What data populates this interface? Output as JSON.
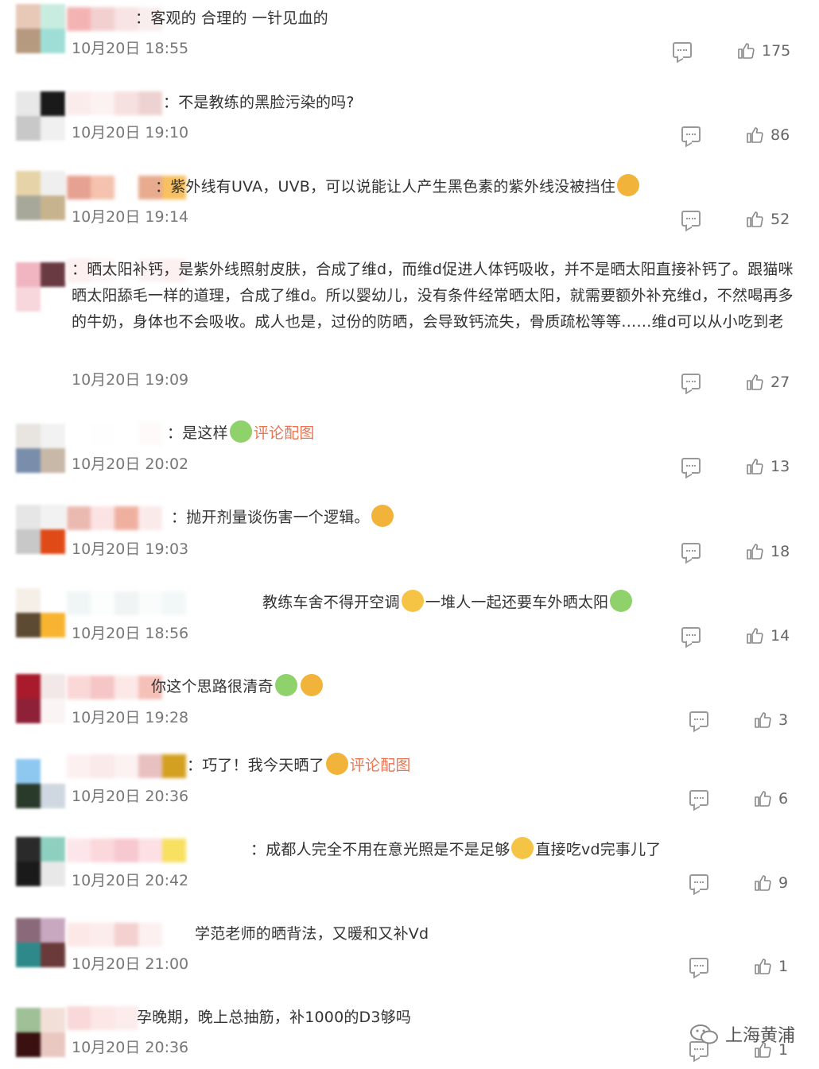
{
  "comments": [
    {
      "text": "：客观的 合理的 一针见血的",
      "time": "10月20日 18:55",
      "likes": "175",
      "avatar": [
        "#e8c9b8",
        "#c8ede0",
        "#b59a7f",
        "#9fded6"
      ],
      "nick": [
        "#f4b3b3",
        "#f2d0d0",
        "#f8e4e4",
        "#f9eeee"
      ]
    },
    {
      "text": "：不是教练的黑脸污染的吗?",
      "time": "10月20日 19:10",
      "likes": "86",
      "avatar": [
        "#e8e8e8",
        "#1a1a1a",
        "#c8c8c8",
        "#f0f0f0"
      ],
      "nick": [
        "#fbecec",
        "#fdf2f2",
        "#f7e0e0",
        "#eed2d2"
      ]
    },
    {
      "text": "：紫外线有UVA，UVB，可以说能让人产生黑色素的紫外线没被挡住",
      "time": "10月20日 19:14",
      "likes": "52",
      "avatar": [
        "#e6d4a8",
        "#efefef",
        "#a8a89a",
        "#c7b38e"
      ],
      "nick": [
        "#e6a190",
        "#f4c2ae",
        "#ffffff",
        "#e8ab8e",
        "#f7c060"
      ]
    },
    {
      "text": "：晒太阳补钙，是紫外线照射皮肤，合成了维d，而维d促进人体钙吸收，并不是晒太阳直接补钙了。跟猫咪晒太阳舔毛一样的道理，合成了维d。所以婴幼儿，没有条件经常晒太阳，就需要额外补充维d，不然喝再多的牛奶，身体也不会吸收。成人也是，过份的防晒，会导致钙流失，骨质疏松等等……维d可以从小吃到老",
      "time": "10月20日 19:09",
      "likes": "27",
      "avatar": [
        "#f0b5c1",
        "#6a3a42",
        "#f7d6dc",
        "#ffffff"
      ],
      "nick": [
        "#fcf0f0",
        "#fef6f6",
        "#ffffff",
        "#fcf4f4",
        "#fdf0f0"
      ]
    },
    {
      "text": "：是这样",
      "link": "评论配图",
      "time": "10月20日 20:02",
      "likes": "13",
      "avatar": [
        "#e8e4e0",
        "#f2f2f2",
        "#7a8dab",
        "#c8b8a8"
      ],
      "nick": [
        "#ffffff",
        "#fefefe",
        "#ffffff",
        "#fefafa"
      ]
    },
    {
      "text": "：抛开剂量谈伤害一个逻辑。",
      "time": "10月20日 19:03",
      "likes": "18",
      "avatar": [
        "#e6e6e6",
        "#f2f2f2",
        "#c8c8c8",
        "#e04a17"
      ],
      "nick": [
        "#eab9b0",
        "#fbe3e3",
        "#f0b0a0",
        "#fbeaea",
        "#ffffff"
      ]
    },
    {
      "text": "教练车舍不得开空调",
      "text2": "一堆人一起还要车外晒太阳",
      "time": "10月20日 18:56",
      "likes": "14",
      "avatar": [
        "#f6efe8",
        "#ffffff",
        "#5c4a32",
        "#f8b430"
      ],
      "nick": [
        "#f0f6f6",
        "#fcfefe",
        "#f0f4f4",
        "#fafcfc",
        "#f2f8f8"
      ]
    },
    {
      "text": "你这个思路很清奇",
      "time": "10月20日 19:28",
      "likes": "3",
      "avatar": [
        "#a81a2c",
        "#f2e8e8",
        "#8e2038",
        "#fbf4f4"
      ],
      "nick": [
        "#fad8d8",
        "#f6c5c5",
        "#fde8e8",
        "#f5c0b8"
      ]
    },
    {
      "text": "：巧了！我今天晒了",
      "link": "评论配图",
      "time": "10月20日 20:36",
      "likes": "6",
      "avatar": [
        "#8ec8f0",
        "#ffffff",
        "#2a3a2a",
        "#cfd8e0"
      ],
      "nick": [
        "#fdf0f0",
        "#faeaea",
        "#fcf2f2",
        "#e8c0c0",
        "#d4a020"
      ]
    },
    {
      "text": "：成都人完全不用在意光照是不是足够",
      "text2": "直接吃vd完事儿了",
      "time": "10月20日 20:42",
      "likes": "9",
      "avatar": [
        "#2a2a2a",
        "#8ed0c0",
        "#1a1a1a",
        "#e8e8e8"
      ],
      "nick": [
        "#fde6ea",
        "#fbd8dc",
        "#f7c8d0",
        "#fce0e4",
        "#f8e060"
      ]
    },
    {
      "text": "学范老师的晒背法，又暖和又补Vd",
      "time": "10月20日 21:00",
      "likes": "1",
      "avatar": [
        "#8a6a7a",
        "#c8a8c0",
        "#2e8a8a",
        "#6a3a3a"
      ],
      "nick": [
        "#fde8e8",
        "#fcecec",
        "#f4d0d0",
        "#fdf0f0"
      ]
    },
    {
      "text": "孕晚期，晚上总抽筋，补1000的D3够吗",
      "time": "10月20日 20:36",
      "likes": "1",
      "avatar": [
        "#a0c098",
        "#f2e0d8",
        "#3a1010",
        "#e8c8c0"
      ],
      "nick": [
        "#f8d8d8",
        "#fde6e6",
        "#fcecec"
      ]
    }
  ],
  "watermark": "上海黄浦",
  "colors": {
    "link": "#eb7350",
    "time": "#777777",
    "text": "#333333"
  }
}
